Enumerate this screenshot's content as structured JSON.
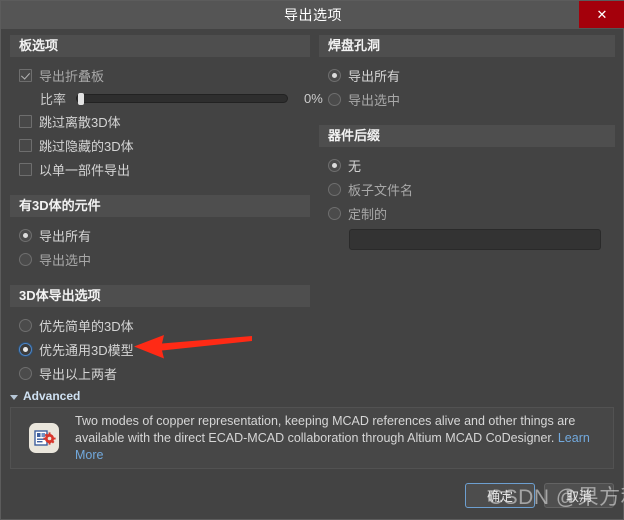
{
  "window": {
    "title": "导出选项",
    "close_label": "✕"
  },
  "board_options": {
    "header": "板选项",
    "checkboxes": [
      {
        "label": "导出折叠板",
        "checked": true
      },
      {
        "label": "跳过离散3D体",
        "checked": false
      },
      {
        "label": "跳过隐藏的3D体",
        "checked": false
      },
      {
        "label": "以单一部件导出",
        "checked": false
      }
    ],
    "slider": {
      "label": "比率",
      "value_text": "0%",
      "percent": 0
    }
  },
  "components_with_3d": {
    "header": "有3D体的元件",
    "options": [
      {
        "label": "导出所有",
        "selected": true
      },
      {
        "label": "导出选中",
        "selected": false
      }
    ]
  },
  "body_export_options": {
    "header": "3D体导出选项",
    "options": [
      {
        "label": "优先简单的3D体",
        "selected": false
      },
      {
        "label": "优先通用3D模型",
        "selected": true
      },
      {
        "label": "导出以上两者",
        "selected": false
      }
    ]
  },
  "pad_holes": {
    "header": "焊盘孔洞",
    "options": [
      {
        "label": "导出所有",
        "selected": true
      },
      {
        "label": "导出选中",
        "selected": false
      }
    ]
  },
  "component_suffix": {
    "header": "器件后缀",
    "options": [
      {
        "label": "无",
        "selected": true
      },
      {
        "label": "板子文件名",
        "selected": false
      },
      {
        "label": "定制的",
        "selected": false
      }
    ],
    "custom_input": {
      "value": "",
      "placeholder": ""
    }
  },
  "advanced": {
    "label": "Advanced",
    "icon_name": "ecad-mcad-icon",
    "description": "Two modes of copper representation, keeping MCAD references alive and other things are available with the direct ECAD-MCAD collaboration through Altium MCAD CoDesigner.",
    "link_label": "Learn More"
  },
  "footer": {
    "ok_label": "确定",
    "cancel_label": "取消"
  },
  "annotation": {
    "arrow_color": "#ff2a15",
    "arrow_target": "优先通用3D模型"
  },
  "watermark": {
    "text": "CSDN @果方利"
  }
}
